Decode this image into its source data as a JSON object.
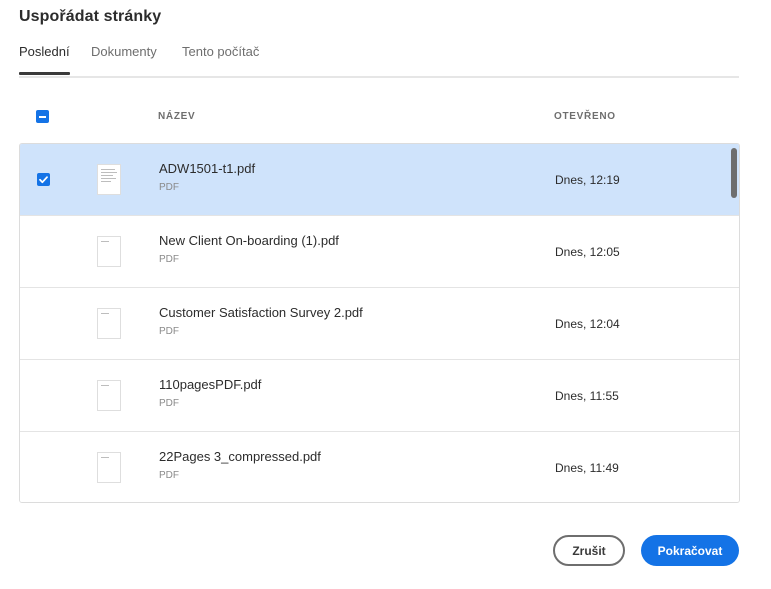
{
  "dialog": {
    "title": "Uspořádat stránky"
  },
  "tabs": [
    {
      "label": "Poslední",
      "active": true
    },
    {
      "label": "Dokumenty",
      "active": false
    },
    {
      "label": "Tento počítač",
      "active": false
    }
  ],
  "table": {
    "columns": {
      "name": "NÁZEV",
      "opened": "OTEVŘENO"
    },
    "header_checkbox_state": "indeterminate",
    "rows": [
      {
        "name": "ADW1501-t1.pdf",
        "type": "PDF",
        "opened": "Dnes, 12:19",
        "selected": true
      },
      {
        "name": "New Client On-boarding (1).pdf",
        "type": "PDF",
        "opened": "Dnes, 12:05",
        "selected": false
      },
      {
        "name": "Customer Satisfaction Survey 2.pdf",
        "type": "PDF",
        "opened": "Dnes, 12:04",
        "selected": false
      },
      {
        "name": "110pagesPDF.pdf",
        "type": "PDF",
        "opened": "Dnes, 11:55",
        "selected": false
      },
      {
        "name": "22Pages 3_compressed.pdf",
        "type": "PDF",
        "opened": "Dnes, 11:49",
        "selected": false
      }
    ]
  },
  "buttons": {
    "cancel": "Zrušit",
    "continue": "Pokračovat"
  },
  "colors": {
    "accent": "#1473e6",
    "selected_row": "#cfe3fb"
  }
}
